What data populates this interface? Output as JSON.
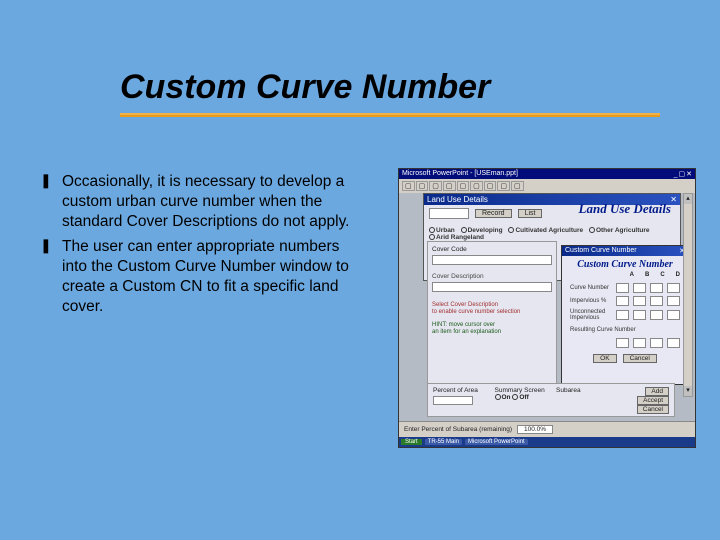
{
  "slide": {
    "title": "Custom Curve Number",
    "bullets": [
      "Occasionally, it is necessary to develop a custom urban curve number when the standard Cover Descriptions do not apply.",
      "The user can enter appropriate numbers into the Custom Curve Number window to create a Custom CN to fit a specific land cover."
    ]
  },
  "screenshot": {
    "app_title": "Microsoft PowerPoint - [USEman.ppt]",
    "subwindow": {
      "title": "Land Use Details",
      "record_btn": "Record",
      "list_btn": "List"
    },
    "lud_title": "Land Use Details",
    "radios": [
      "Urban",
      "Developing",
      "Cultivated Agriculture",
      "Other Agriculture",
      "Arid Rangeland"
    ],
    "left_panel": {
      "section": "Cover Code",
      "field1_label": "Cover Description",
      "hint_red_1": "Select Cover Description",
      "hint_red_2": "to enable curve number selection",
      "hint_green_1": "HINT: move cursor over",
      "hint_green_2": "an item for an explanation"
    },
    "ccn_window": {
      "title": "Custom Curve Number",
      "heading": "Custom Curve Number",
      "cols": [
        "A",
        "B",
        "C",
        "D"
      ],
      "rows": [
        "Curve Number",
        "Impervious %",
        "Unconnected Impervious"
      ],
      "section2": "Resulting Curve Number",
      "buttons": [
        "OK",
        "Cancel"
      ]
    },
    "lower": {
      "group1": "Percent of Area",
      "group2": "Summary Screen",
      "group3": "Subarea",
      "radio_on": "On",
      "radio_off": "Off",
      "btns": [
        "Add",
        "Accept",
        "Cancel"
      ]
    },
    "status": {
      "label": "Enter Percent of Subarea (remaining)",
      "value": "100.0%"
    },
    "taskbar": {
      "start": "Start",
      "items": [
        "TR-55 Main",
        "Microsoft PowerPoint"
      ]
    }
  }
}
